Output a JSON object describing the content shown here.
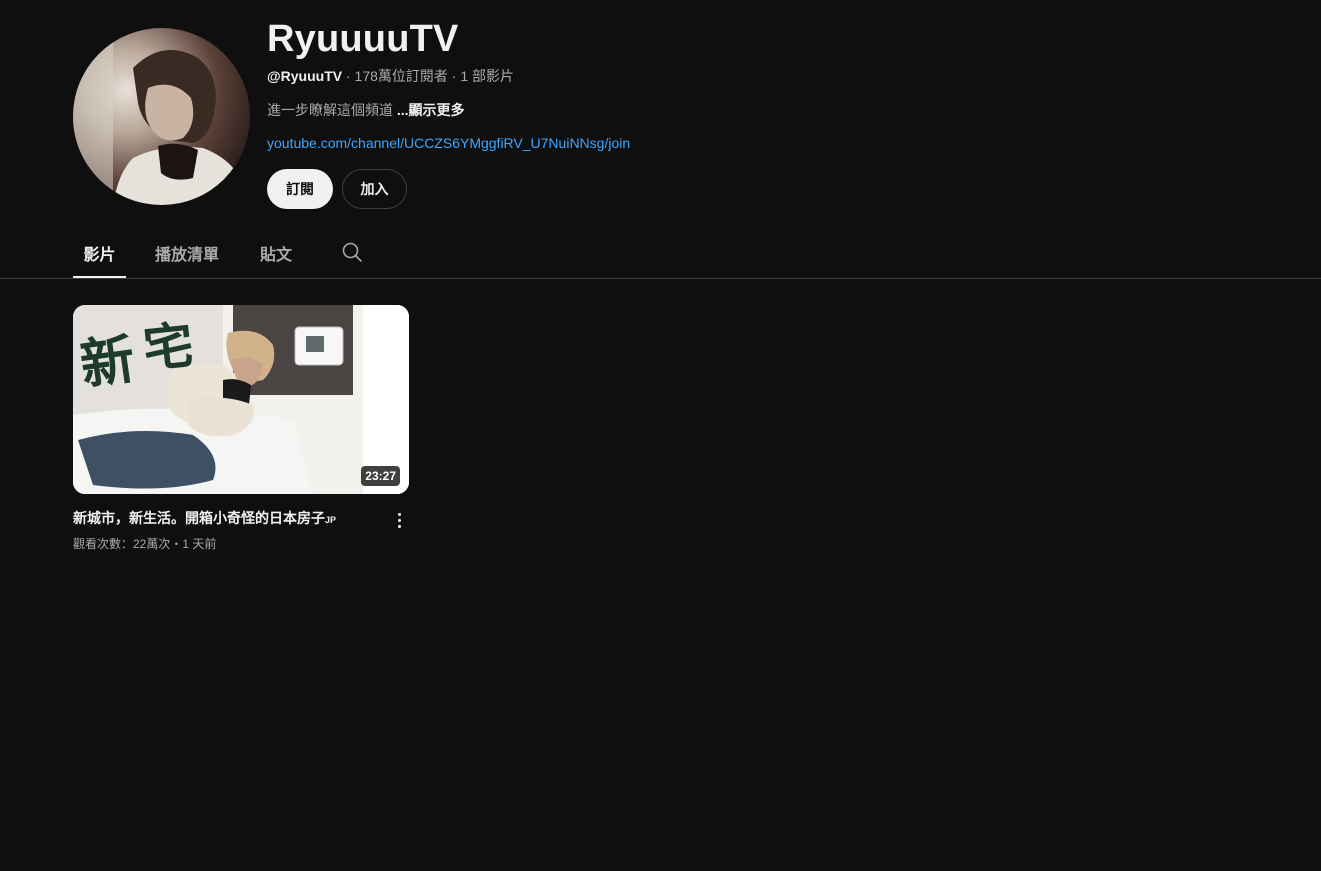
{
  "channel": {
    "name": "RyuuuuTV",
    "handle": "@RyuuuTV",
    "stats_suffix": " · 178萬位訂閱者 · 1 部影片",
    "description": "進一步瞭解這個頻道 ",
    "more_label": "...顯示更多",
    "link": "youtube.com/channel/UCCZS6YMggfiRV_U7NuiNNsg/join",
    "subscribe_label": "訂閱",
    "join_label": "加入"
  },
  "tabs": {
    "videos": "影片",
    "playlists": "播放清單",
    "posts": "貼文",
    "search_icon": "search-icon"
  },
  "video": {
    "thumbnail_text": "新宅",
    "duration": "23:27",
    "title": "新城市，新生活。開箱小奇怪的日本房子",
    "title_suffix": "JP",
    "meta": "觀看次數：22萬次・1 天前"
  },
  "colors": {
    "background": "#0f0f0f",
    "link": "#3ea6ff",
    "text_primary": "#f1f1f1",
    "text_secondary": "#aaaaaa"
  }
}
